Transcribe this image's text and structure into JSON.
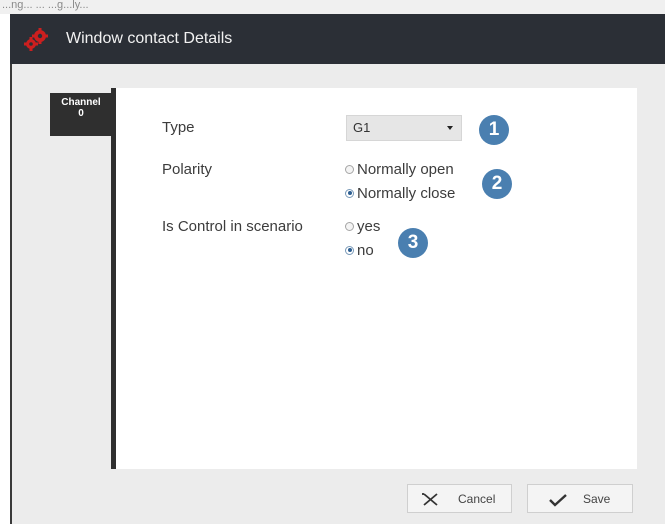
{
  "top_strip_text": "...ng... ... ...g...ly...",
  "window": {
    "title": "Window contact Details",
    "icon": "gears-icon"
  },
  "channel_tab": {
    "line1": "Channel",
    "line2": "0"
  },
  "form": {
    "type": {
      "label": "Type",
      "value": "G1"
    },
    "polarity": {
      "label": "Polarity",
      "options": [
        {
          "label": "Normally open",
          "selected": false
        },
        {
          "label": "Normally close",
          "selected": true
        }
      ]
    },
    "control": {
      "label": "Is Control in scenario",
      "options": [
        {
          "label": "yes",
          "selected": false
        },
        {
          "label": "no",
          "selected": true
        }
      ]
    }
  },
  "badges": [
    "1",
    "2",
    "3"
  ],
  "buttons": {
    "cancel": {
      "label": "Cancel",
      "icon": "close-icon"
    },
    "save": {
      "label": "Save",
      "icon": "checkmark-icon"
    }
  },
  "colors": {
    "titlebar": "#2b2f36",
    "badge": "#4a7fb0",
    "radio_selected": "#2e5f92",
    "gear": "#cc1f1f"
  }
}
